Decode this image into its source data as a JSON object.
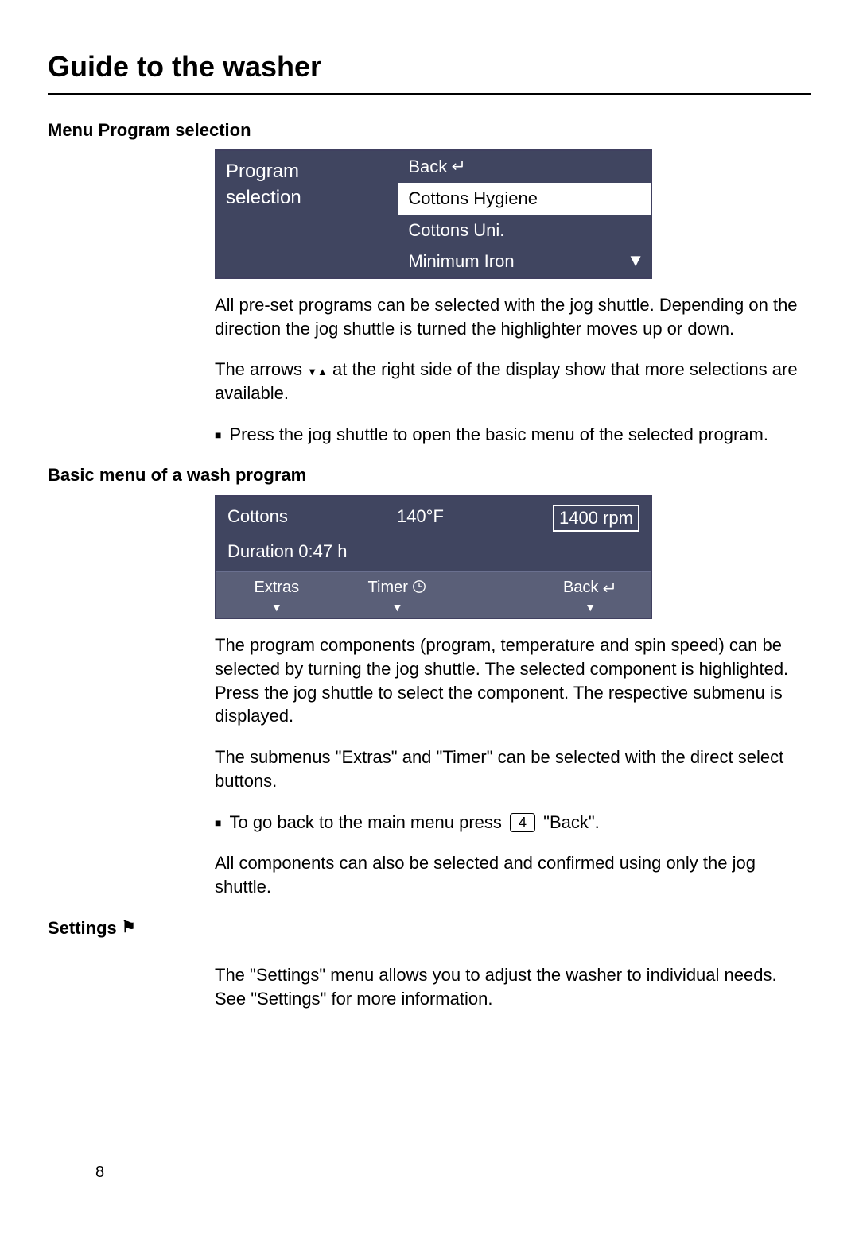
{
  "page": {
    "title": "Guide to the washer",
    "number": "8"
  },
  "section1": {
    "heading": "Menu Program selection",
    "display": {
      "left_line1": "Program",
      "left_line2": "selection",
      "back_label": "Back",
      "items": [
        "Cottons Hygiene",
        "Cottons Uni.",
        "Minimum Iron"
      ]
    },
    "para1": "All pre-set programs can be selected with the jog shuttle. Depending on the direction the jog shuttle is turned the highlighter moves up or down.",
    "para2_pre": "The arrows ",
    "para2_post": " at the right side of the display show that more selections are available.",
    "bullet1": "Press the jog shuttle to open the basic menu of the selected program."
  },
  "section2": {
    "heading": "Basic menu of a wash program",
    "display": {
      "program": "Cottons",
      "temp": "140°F",
      "spin": "1400 rpm",
      "duration_label": "Duration 0:47 h",
      "extras": "Extras",
      "timer": "Timer",
      "back": "Back"
    },
    "para1": "The program components (program, temperature and spin speed) can be selected by turning the jog shuttle. The selected component is highlighted. Press the jog shuttle to select the component. The respective submenu is displayed.",
    "para2": "The submenus \"Extras\" and \"Timer\" can be selected with the direct select buttons.",
    "bullet1_pre": "To go back to the main menu press ",
    "bullet1_key": "4",
    "bullet1_post": " \"Back\".",
    "para3": "All components can also be selected and confirmed using only the jog shuttle."
  },
  "section3": {
    "heading": "Settings",
    "para1": "The \"Settings\" menu allows you to adjust the washer to individual needs. See \"Settings\" for more information."
  }
}
